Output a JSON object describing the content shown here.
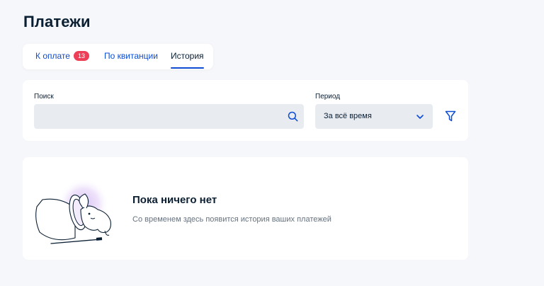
{
  "page": {
    "title": "Платежи"
  },
  "tabs": [
    {
      "label": "К оплате",
      "badge": "13",
      "active": false
    },
    {
      "label": "По квитанции",
      "active": false
    },
    {
      "label": "История",
      "active": true
    }
  ],
  "filters": {
    "search": {
      "label": "Поиск",
      "value": "",
      "placeholder": ""
    },
    "period": {
      "label": "Период",
      "value": "За всё время"
    }
  },
  "empty_state": {
    "title": "Пока ничего нет",
    "subtitle": "Со временем здесь появится история ваших платежей"
  },
  "colors": {
    "accent": "#0d4cd3",
    "badge": "#ee3f58",
    "background": "#f5f7fa",
    "field": "#e8ecf1"
  },
  "icons": [
    "search-icon",
    "chevron-down-icon",
    "filter-icon",
    "empty-hat-illustration"
  ]
}
